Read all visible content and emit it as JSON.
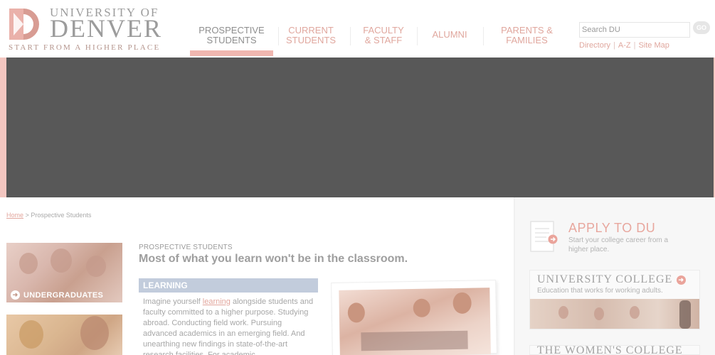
{
  "header": {
    "logo_line1": "UNIVERSITY OF",
    "logo_line2": "DENVER",
    "logo_tagline": "START FROM A HIGHER PLACE"
  },
  "nav": {
    "items": [
      {
        "label": "PROSPECTIVE\nSTUDENTS",
        "active": true
      },
      {
        "label": "CURRENT\nSTUDENTS",
        "active": false
      },
      {
        "label": "FACULTY\n& STAFF",
        "active": false
      },
      {
        "label": "ALUMNI",
        "active": false
      },
      {
        "label": "PARENTS &\nFAMILIES",
        "active": false
      }
    ]
  },
  "search": {
    "value": "Search DU",
    "go_label": "GO"
  },
  "utility_links": [
    "Directory",
    "A-Z",
    "Site Map"
  ],
  "breadcrumb": {
    "home": "Home",
    "separator": ">",
    "current": "Prospective Students"
  },
  "cards": {
    "undergrad_label": "UNDERGRADUATES"
  },
  "main": {
    "kicker": "PROSPECTIVE STUDENTS",
    "headline": "Most of what you learn won't be in the classroom.",
    "section_title": "LEARNING",
    "body_before_link": "Imagine yourself ",
    "body_link": "learning",
    "body_after_link": " alongside students and faculty committed to a higher purpose. Studying abroad. Conducting field work. Pursuing advanced academics in an emerging field. And unearthing new findings in state-of-the-art research facilities. For academic"
  },
  "sidebar": {
    "apply_title": "APPLY TO DU",
    "apply_sub": "Start your college career from a higher place.",
    "uc_title": "UNIVERSITY COLLEGE",
    "uc_sub": "Education that works for working adults.",
    "wc_title": "THE WOMEN'S COLLEGE"
  },
  "colors": {
    "accent_pink": "#e0a79e",
    "nav_underline": "#f0b7b0",
    "hero_dark": "#585858",
    "section_bar": "#c2ccdc"
  }
}
